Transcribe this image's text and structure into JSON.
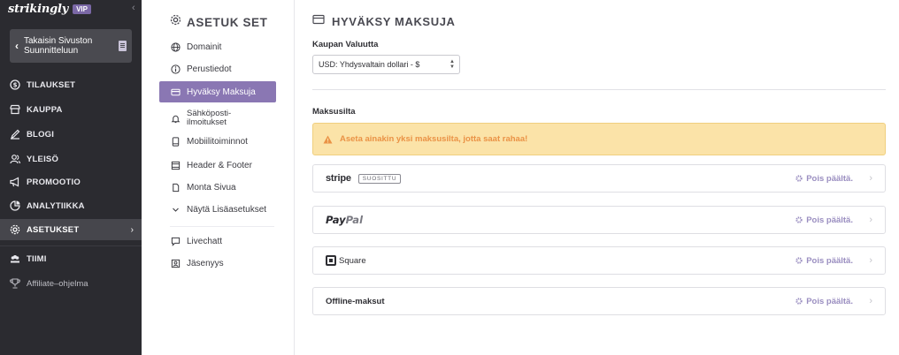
{
  "brand": {
    "logo_text": "strikingly",
    "badge": "VIP"
  },
  "sidebar": {
    "back_button_label": "Takaisin Sivuston Suunnitteluun",
    "items": [
      {
        "label": "TILAUKSET",
        "icon": "dollar-icon"
      },
      {
        "label": "KAUPPA",
        "icon": "store-icon"
      },
      {
        "label": "BLOGI",
        "icon": "pen-icon"
      },
      {
        "label": "YLEISÖ",
        "icon": "audience-icon"
      },
      {
        "label": "PROMOOTIO",
        "icon": "megaphone-icon"
      },
      {
        "label": "ANALYTIIKKA",
        "icon": "analytics-icon"
      },
      {
        "label": "ASETUKSET",
        "icon": "gear-icon",
        "active": true
      },
      {
        "label": "TIIMI",
        "icon": "team-icon"
      },
      {
        "label": "Affiliate–ohjelma",
        "icon": "trophy-icon"
      }
    ]
  },
  "subnav": {
    "title": "ASETUK SET",
    "items": [
      {
        "label": "Domainit",
        "icon": "globe-icon"
      },
      {
        "label": "Perustiedot",
        "icon": "info-icon"
      },
      {
        "label": "Hyväksy Maksuja",
        "icon": "card-icon",
        "active": true
      },
      {
        "label": "Sähköposti-ilmoitukset",
        "label_line1": "Sähköposti-",
        "label_line2": "ilmoitukset",
        "icon": "bell-icon"
      },
      {
        "label": "Mobiilitoiminnot",
        "icon": "mobile-icon"
      },
      {
        "label": "Header & Footer",
        "icon": "layout-icon"
      },
      {
        "label": "Monta Sivua",
        "icon": "pages-icon"
      },
      {
        "label": "Näytä Lisäasetukset",
        "icon": "chevron-down-icon"
      },
      {
        "label": "Livechatt",
        "icon": "chat-icon"
      },
      {
        "label": "Jäsenyys",
        "icon": "member-icon"
      }
    ]
  },
  "main": {
    "title": "HYVÄKSY MAKSUJA",
    "currency_label": "Kaupan Valuutta",
    "currency_value": "USD: Yhdysvaltain dollari - $",
    "gateways_label": "Maksusilta",
    "warning_text": "Aseta ainakin yksi maksusilta, jotta saat rahaa!",
    "gateways": [
      {
        "name": "stripe",
        "badge": "SUOSITTU",
        "status": "Pois päältä."
      },
      {
        "name_part1": "Pay",
        "name_part2": "Pal",
        "status": "Pois päältä."
      },
      {
        "name": "Square",
        "status": "Pois päältä."
      },
      {
        "name": "Offline-maksut",
        "status": "Pois päältä."
      }
    ]
  },
  "colors": {
    "sidebar_bg": "#2b2b30",
    "accent": "#8a77b3",
    "warning_bg": "#fbe3a8",
    "warning_text": "#ea9245"
  }
}
